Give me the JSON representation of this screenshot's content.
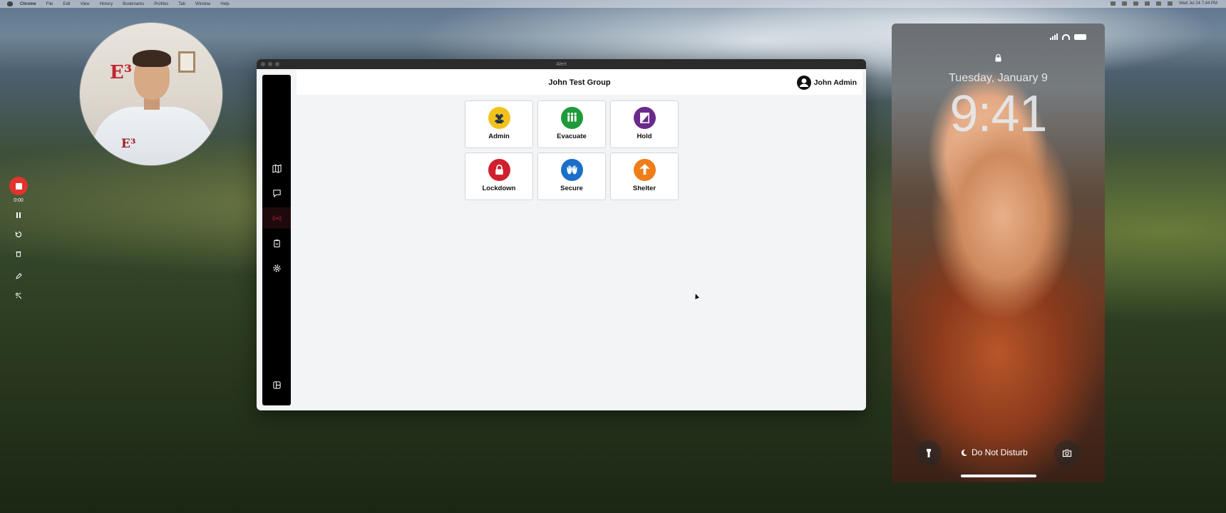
{
  "menubar": {
    "items": [
      "Chrome",
      "File",
      "Edit",
      "View",
      "History",
      "Bookmarks",
      "Profiles",
      "Tab",
      "Window",
      "Help"
    ],
    "clock": "Wed Jul 24 7:44 PM"
  },
  "recorder": {
    "elapsed": "0:00",
    "icons": [
      "stop-icon",
      "pause-icon",
      "restart-icon",
      "trash-icon",
      "pencil-icon",
      "effects-icon"
    ]
  },
  "window": {
    "title": "Alert",
    "header": {
      "group_title": "John Test Group",
      "user_name": "John Admin"
    },
    "rail": {
      "icons": [
        "map-icon",
        "chat-icon",
        "broadcast-icon",
        "clipboard-icon",
        "gear-icon",
        "layout-icon"
      ]
    },
    "tiles": [
      {
        "label": "Admin",
        "color": "#f2c21b",
        "icon": "group-icon"
      },
      {
        "label": "Evacuate",
        "color": "#1f9a3a",
        "icon": "people-exit-icon"
      },
      {
        "label": "Hold",
        "color": "#6a2a8c",
        "icon": "door-icon"
      },
      {
        "label": "Lockdown",
        "color": "#d0202e",
        "icon": "lock-icon"
      },
      {
        "label": "Secure",
        "color": "#1a6fc9",
        "icon": "hands-icon"
      },
      {
        "label": "Shelter",
        "color": "#ef7d1a",
        "icon": "arrow-up-icon"
      }
    ]
  },
  "phone": {
    "date": "Tuesday, January 9",
    "time": "9:41",
    "focus_label": "Do Not Disturb"
  }
}
